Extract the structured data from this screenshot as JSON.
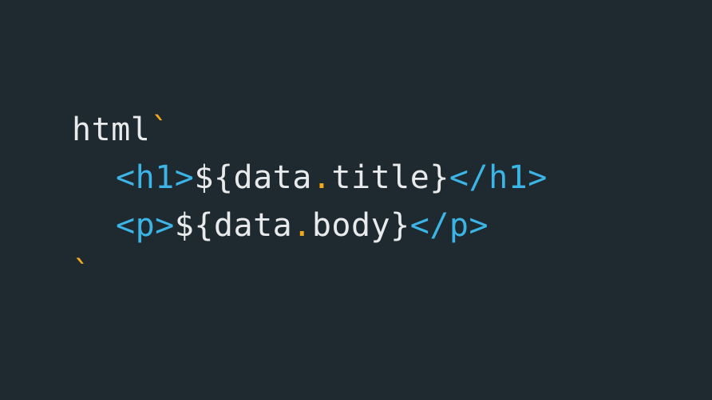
{
  "code": {
    "line1": {
      "keyword": "html",
      "open_tick": "`"
    },
    "line2": {
      "open_tag": "<h1>",
      "expr_start": "${data",
      "dot": ".",
      "expr_end": "title}",
      "close_tag": "</h1>"
    },
    "line3": {
      "open_tag": "<p>",
      "expr_start": "${data",
      "dot": ".",
      "expr_end": "body}",
      "close_tag": "</p>"
    },
    "line4": {
      "close_tick": "`"
    }
  },
  "colors": {
    "background": "#1e2930",
    "text": "#e8eaec",
    "tag": "#3cb4e5",
    "accent": "#f2a81d"
  }
}
